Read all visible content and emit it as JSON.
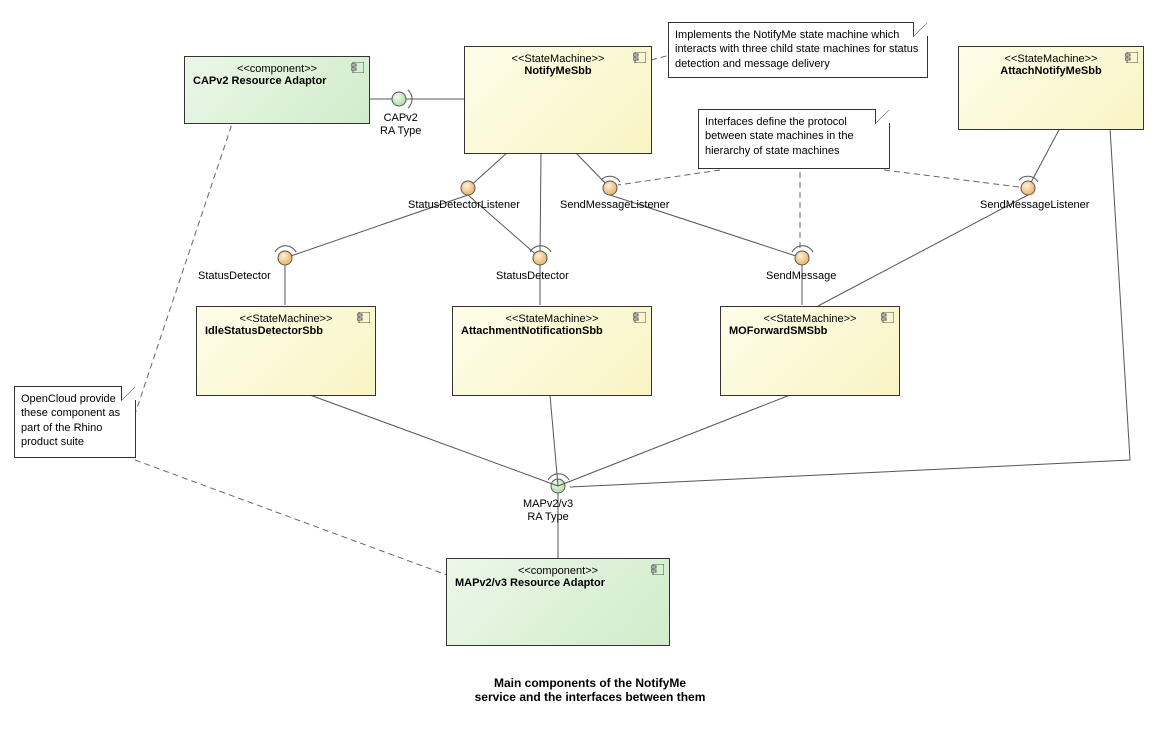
{
  "boxes": {
    "capv2": {
      "stereo": "<<component>>",
      "name": "CAPv2 Resource Adaptor"
    },
    "notifymesbb": {
      "stereo": "<<StateMachine>>",
      "name": "NotifyMeSbb"
    },
    "attachnotify": {
      "stereo": "<<StateMachine>>",
      "name": "AttachNotifyMeSbb"
    },
    "idlestatus": {
      "stereo": "<<StateMachine>>",
      "name": "IdleStatusDetectorSbb"
    },
    "attachnotif": {
      "stereo": "<<StateMachine>>",
      "name": "AttachmentNotificationSbb"
    },
    "moforward": {
      "stereo": "<<StateMachine>>",
      "name": "MOForwardSMSbb"
    },
    "mapv2": {
      "stereo": "<<component>>",
      "name": "MAPv2/v3 Resource Adaptor"
    }
  },
  "notes": {
    "impl": "Implements the NotifyMe state machine which interacts with three child state machines for status detection and message delivery",
    "interfaces": "Interfaces define the protocol between state machines in the hierarchy of state machines",
    "opencloud": "OpenCloud provide these component as part of the Rhino product suite"
  },
  "labels": {
    "capv2ra": "CAPv2\nRA Type",
    "statusDetectorListener": "StatusDetectorListener",
    "sendMessageListener": "SendMessageListener",
    "sendMessageListener2": "SendMessageListener",
    "statusDetector1": "StatusDetector",
    "statusDetector2": "StatusDetector",
    "sendMessage": "SendMessage",
    "mapv2ra": "MAPv2/v3\nRA Type"
  },
  "caption": "Main components of the NotifyMe\nservice and the interfaces between them"
}
